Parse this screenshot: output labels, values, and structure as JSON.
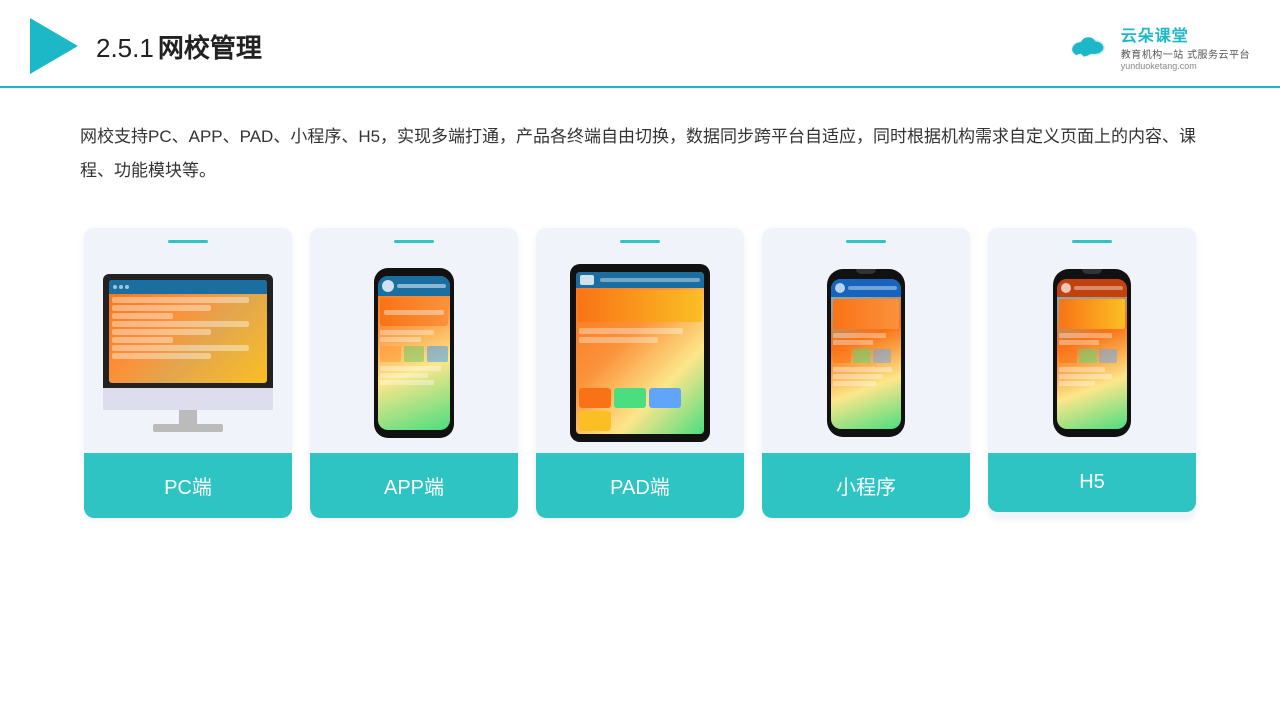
{
  "header": {
    "section_number": "2.5.1",
    "title": "网校管理",
    "brand_name": "云朵课堂",
    "brand_url": "yunduoketang.com",
    "brand_tagline": "教育机构一站",
    "brand_tagline2": "式服务云平台"
  },
  "description": "网校支持PC、APP、PAD、小程序、H5，实现多端打通，产品各终端自由切换，数据同步跨平台自适应，同时根据机构需求自定义页面上的内容、课程、功能模块等。",
  "cards": [
    {
      "id": "pc",
      "label": "PC端"
    },
    {
      "id": "app",
      "label": "APP端"
    },
    {
      "id": "pad",
      "label": "PAD端"
    },
    {
      "id": "miniprogram",
      "label": "小程序"
    },
    {
      "id": "h5",
      "label": "H5"
    }
  ]
}
